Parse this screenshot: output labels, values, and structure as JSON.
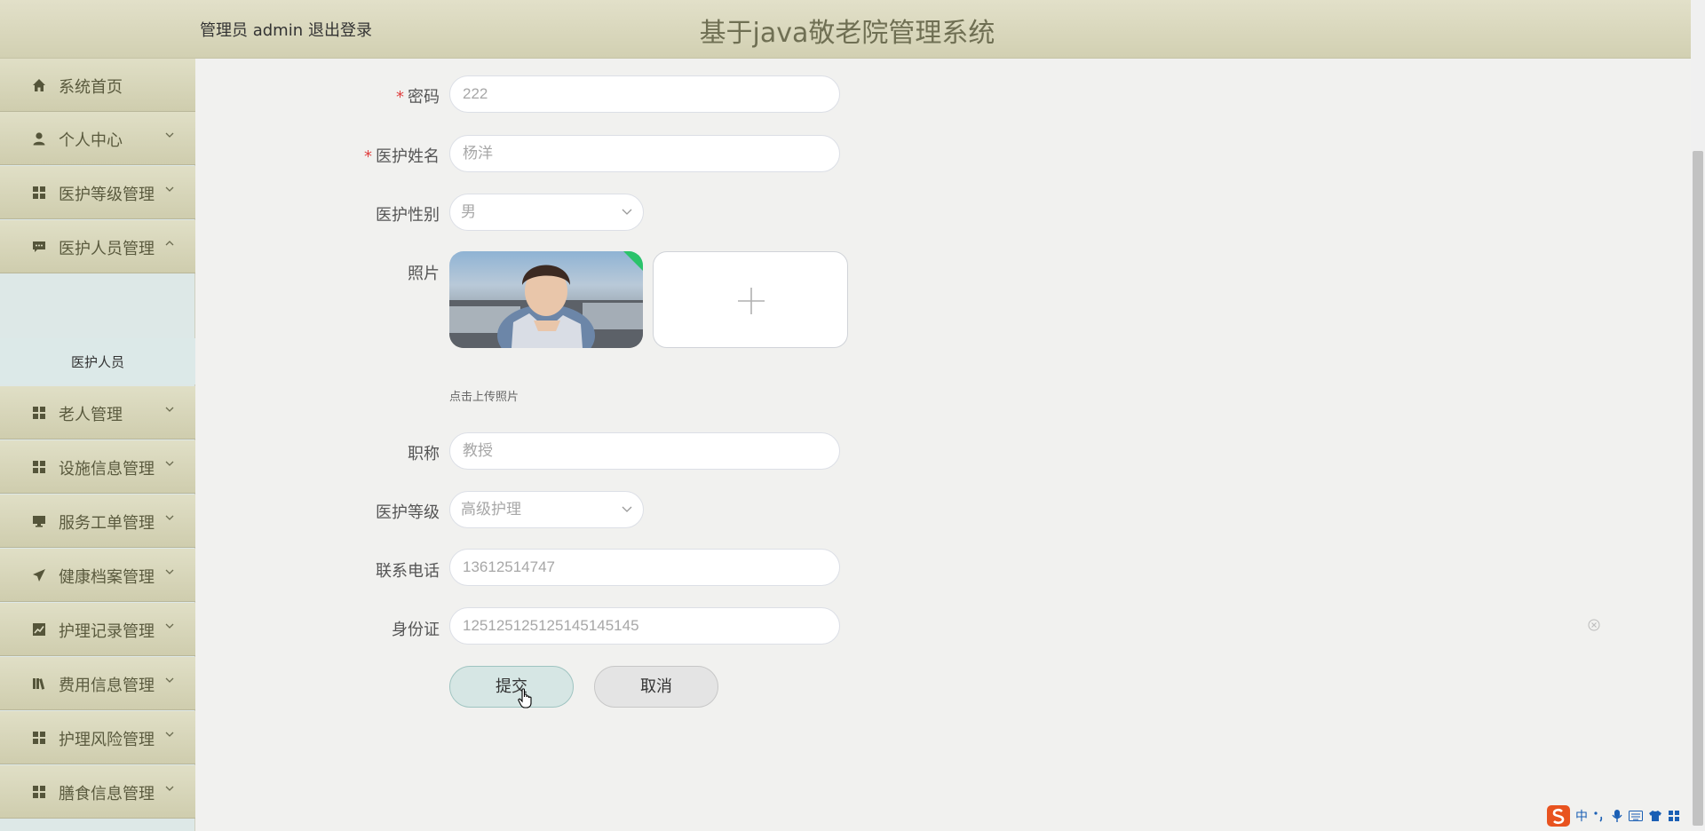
{
  "header": {
    "user_label": "管理员 admin",
    "logout_label": "退出登录",
    "title": "基于java敬老院管理系统"
  },
  "sidebar": {
    "items": [
      {
        "label": "系统首页",
        "icon": "home-icon"
      },
      {
        "label": "个人中心",
        "icon": "user-icon"
      },
      {
        "label": "医护等级管理",
        "icon": "grid-icon"
      },
      {
        "label": "医护人员管理",
        "icon": "chat-icon",
        "expanded": true
      },
      {
        "label": "老人管理",
        "icon": "grid-icon"
      },
      {
        "label": "设施信息管理",
        "icon": "grid-icon"
      },
      {
        "label": "服务工单管理",
        "icon": "monitor-icon"
      },
      {
        "label": "健康档案管理",
        "icon": "paper-plane-icon"
      },
      {
        "label": "护理记录管理",
        "icon": "chart-icon"
      },
      {
        "label": "费用信息管理",
        "icon": "book-icon"
      },
      {
        "label": "护理风险管理",
        "icon": "grid-icon"
      },
      {
        "label": "膳食信息管理",
        "icon": "grid-icon"
      }
    ],
    "submenu": {
      "label": "医护人员"
    }
  },
  "form": {
    "password": {
      "label": "密码",
      "value": "222",
      "required": true
    },
    "name": {
      "label": "医护姓名",
      "value": "杨洋",
      "required": true
    },
    "gender": {
      "label": "医护性别",
      "value": "男"
    },
    "photo": {
      "label": "照片",
      "tip": "点击上传照片"
    },
    "title": {
      "label": "职称",
      "value": "教授"
    },
    "level": {
      "label": "医护等级",
      "value": "高级护理"
    },
    "phone": {
      "label": "联系电话",
      "value": "13612514747"
    },
    "idcard": {
      "label": "身份证",
      "value": "125125125125145145145"
    },
    "submit_label": "提交",
    "cancel_label": "取消"
  },
  "ime": {
    "lang": "中"
  }
}
